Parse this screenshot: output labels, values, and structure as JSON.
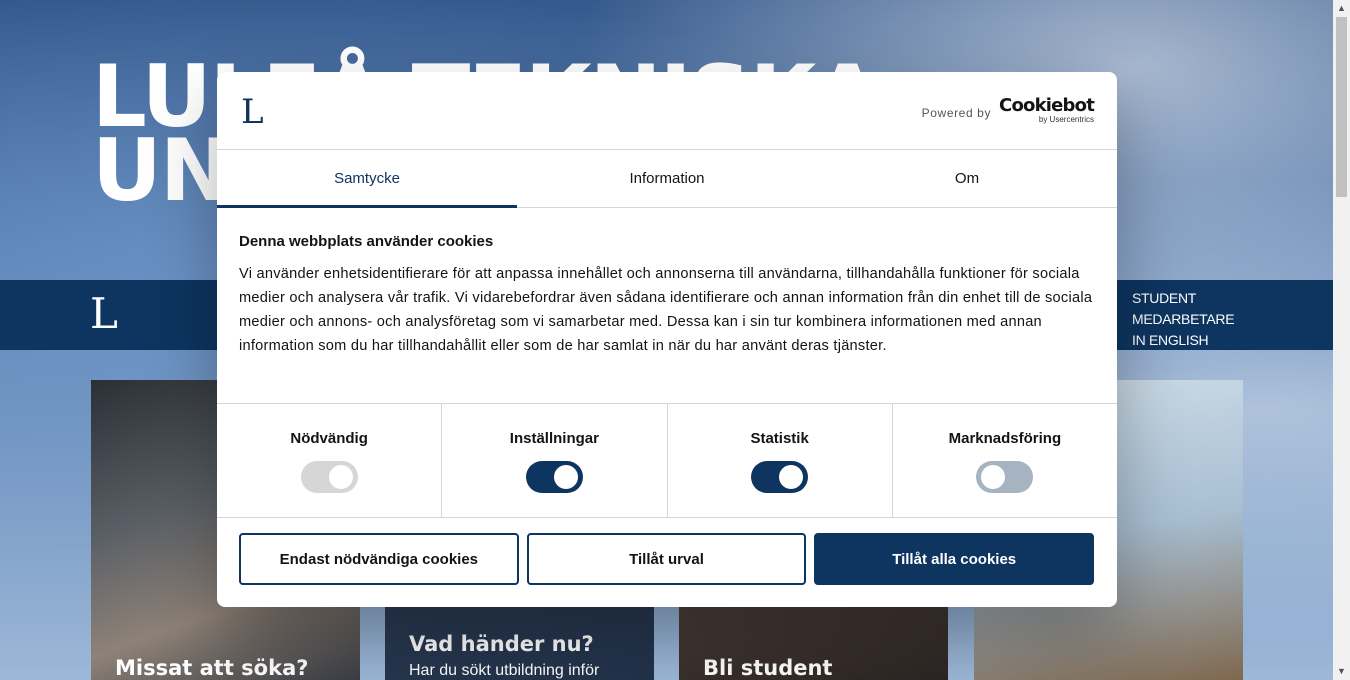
{
  "background": {
    "hero_title_lines": [
      "LULEÅ TEKNISKA",
      "UNIVERSITET"
    ],
    "nav_logo": "L",
    "nav_links": [
      "STUDENT",
      "MEDARBETARE",
      "IN ENGLISH"
    ],
    "cards": [
      {
        "title": "Missat att söka?",
        "subtitle": ""
      },
      {
        "title": "Vad händer nu?",
        "subtitle": "Har du sökt utbildning inför"
      },
      {
        "title": "Bli student",
        "subtitle": ""
      },
      {
        "title": "",
        "subtitle": ""
      }
    ]
  },
  "dialog": {
    "logo": "L",
    "powered_by_label": "Powered by",
    "cookiebot_name": "Cookiebot",
    "cookiebot_by": "by Usercentrics",
    "tabs": [
      {
        "label": "Samtycke",
        "active": true
      },
      {
        "label": "Information",
        "active": false
      },
      {
        "label": "Om",
        "active": false
      }
    ],
    "body_title": "Denna webbplats använder cookies",
    "body_text": "Vi använder enhetsidentifierare för att anpassa innehållet och annonserna till användarna, tillhandahålla funktioner för sociala medier och analysera vår trafik. Vi vidarebefordrar även sådana identifierare och annan information från din enhet till de sociala medier och annons- och analysföretag som vi samarbetar med. Dessa kan i sin tur kombinera informationen med annan information som du har tillhandahållit eller som de har samlat in när du har använt deras tjänster.",
    "toggles": [
      {
        "label": "Nödvändig",
        "state": "on-disabled"
      },
      {
        "label": "Inställningar",
        "state": "on"
      },
      {
        "label": "Statistik",
        "state": "on"
      },
      {
        "label": "Marknadsföring",
        "state": "off"
      }
    ],
    "buttons": {
      "necessary_only": "Endast nödvändiga cookies",
      "allow_selection": "Tillåt urval",
      "allow_all": "Tillåt alla cookies"
    }
  },
  "colors": {
    "brand_navy": "#0d3560",
    "toggle_disabled": "#d6d6d6",
    "toggle_off": "#a6b3c1"
  },
  "icons": {
    "scroll_up": "▲",
    "scroll_down": "▼"
  }
}
